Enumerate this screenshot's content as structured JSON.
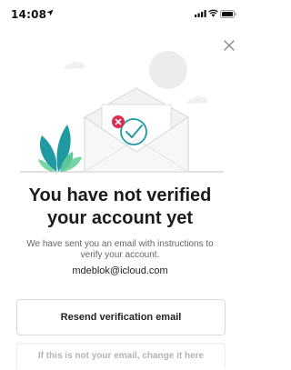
{
  "status_bar": {
    "time": "14:08",
    "icons": [
      "location-arrow-icon",
      "cellular-signal-icon",
      "wifi-icon",
      "battery-icon"
    ]
  },
  "close_icon": "close-icon",
  "illustration": {
    "icons": [
      "envelope-icon",
      "error-x-icon",
      "checkmark-icon",
      "plant-icon"
    ],
    "colors": {
      "envelope": "#f3f3f3",
      "envelope_stroke": "#d8d8d8",
      "error": "#e0294e",
      "check": "#1f9aa3",
      "leaf_dark": "#1f9aa3",
      "leaf_light": "#78d6a3",
      "sun": "#ececec"
    }
  },
  "title": {
    "line1": "You have not verified",
    "line2": "your account yet"
  },
  "subtitle": {
    "line1": "We have sent you an email with instructions to",
    "line2": "verify your account."
  },
  "email": "mdeblok@icloud.com",
  "resend_button_label": "Resend verification email",
  "change_email_label": "If this is not your email, change it here"
}
